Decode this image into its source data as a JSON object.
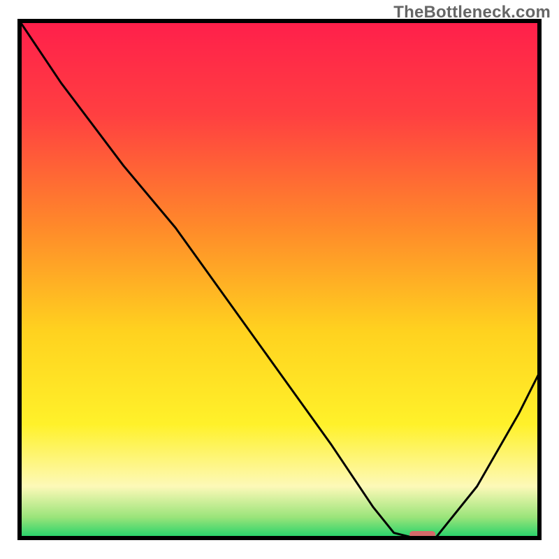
{
  "watermark": "TheBottleneck.com",
  "chart_data": {
    "type": "line",
    "title": "",
    "xlabel": "",
    "ylabel": "",
    "xlim": [
      0,
      100
    ],
    "ylim": [
      0,
      100
    ],
    "grid": false,
    "legend": false,
    "axes_visible": false,
    "background": {
      "type": "vertical-gradient",
      "stops": [
        {
          "offset": 0.0,
          "color": "#ff1f4b"
        },
        {
          "offset": 0.18,
          "color": "#ff3f41"
        },
        {
          "offset": 0.4,
          "color": "#ff8a2a"
        },
        {
          "offset": 0.6,
          "color": "#ffd21f"
        },
        {
          "offset": 0.78,
          "color": "#fff12a"
        },
        {
          "offset": 0.9,
          "color": "#fdf9b8"
        },
        {
          "offset": 0.96,
          "color": "#9ae47a"
        },
        {
          "offset": 1.0,
          "color": "#1fd16a"
        }
      ]
    },
    "series": [
      {
        "name": "bottleneck-curve",
        "color": "#000000",
        "x": [
          0,
          8,
          20,
          30,
          40,
          50,
          60,
          68,
          72,
          76,
          80,
          88,
          96,
          100
        ],
        "y": [
          100,
          88,
          72,
          60,
          46,
          32,
          18,
          6,
          1,
          0,
          0,
          10,
          24,
          32
        ]
      }
    ],
    "marker": {
      "name": "optimal-range",
      "shape": "capsule",
      "x_range": [
        75,
        80
      ],
      "y": 0.7,
      "fill": "#d46a6a",
      "height_pct": 1.3
    },
    "border": {
      "color": "#000000",
      "width": 6
    }
  }
}
